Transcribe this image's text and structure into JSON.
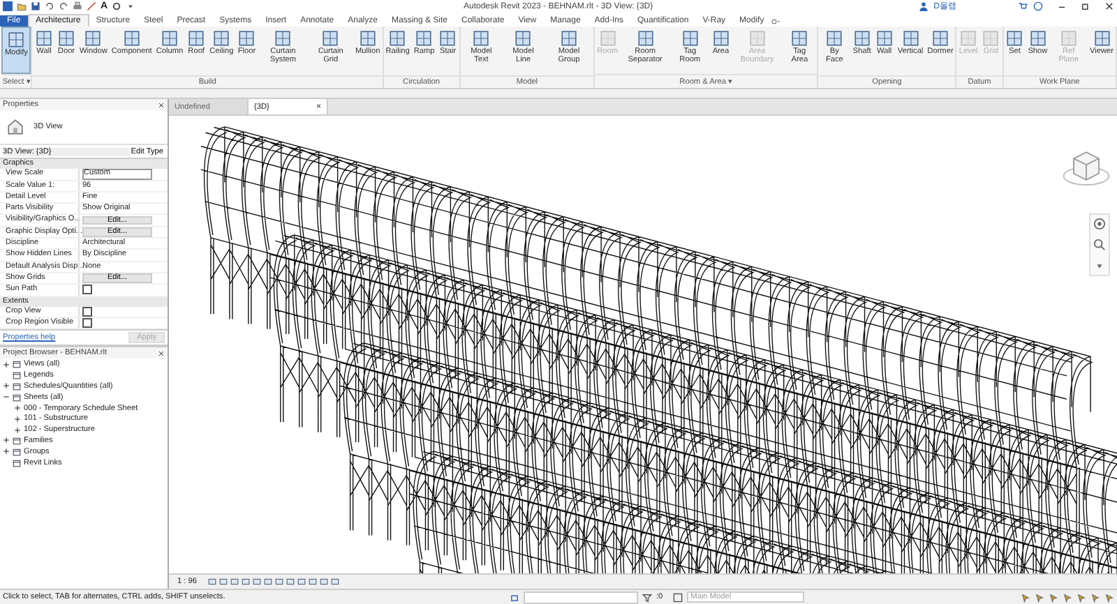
{
  "title_bar": {
    "title": "Autodesk Revit 2023 - BEHNAM.rlt - 3D View: {3D}",
    "user": "D올랩",
    "qat_text": "A"
  },
  "ribbon_tabs": [
    {
      "label": "File",
      "kind": "file",
      "selected": false
    },
    {
      "label": "Architecture",
      "kind": "tab",
      "selected": true
    },
    {
      "label": "Structure",
      "kind": "tab",
      "selected": false
    },
    {
      "label": "Steel",
      "kind": "tab",
      "selected": false
    },
    {
      "label": "Precast",
      "kind": "tab",
      "selected": false
    },
    {
      "label": "Systems",
      "kind": "tab",
      "selected": false
    },
    {
      "label": "Insert",
      "kind": "tab",
      "selected": false
    },
    {
      "label": "Annotate",
      "kind": "tab",
      "selected": false
    },
    {
      "label": "Analyze",
      "kind": "tab",
      "selected": false
    },
    {
      "label": "Massing & Site",
      "kind": "tab",
      "selected": false
    },
    {
      "label": "Collaborate",
      "kind": "tab",
      "selected": false
    },
    {
      "label": "View",
      "kind": "tab",
      "selected": false
    },
    {
      "label": "Manage",
      "kind": "tab",
      "selected": false
    },
    {
      "label": "Add-Ins",
      "kind": "tab",
      "selected": false
    },
    {
      "label": "Quantification",
      "kind": "tab",
      "selected": false
    },
    {
      "label": "V-Ray",
      "kind": "tab",
      "selected": false
    },
    {
      "label": "Modify",
      "kind": "tab",
      "selected": false
    }
  ],
  "ribbon_panels": [
    {
      "label": "Select ▾",
      "tools": [
        {
          "label": "Modify",
          "selected": true,
          "disabled": false
        }
      ]
    },
    {
      "label": "Build",
      "tools": [
        {
          "label": "Wall",
          "selected": false,
          "disabled": false
        },
        {
          "label": "Door",
          "selected": false,
          "disabled": false
        },
        {
          "label": "Window",
          "selected": false,
          "disabled": false
        },
        {
          "label": "Component",
          "selected": false,
          "disabled": false
        },
        {
          "label": "Column",
          "selected": false,
          "disabled": false
        },
        {
          "label": "Roof",
          "selected": false,
          "disabled": false
        },
        {
          "label": "Ceiling",
          "selected": false,
          "disabled": false
        },
        {
          "label": "Floor",
          "selected": false,
          "disabled": false
        },
        {
          "label": "Curtain System",
          "selected": false,
          "disabled": false
        },
        {
          "label": "Curtain Grid",
          "selected": false,
          "disabled": false
        },
        {
          "label": "Mullion",
          "selected": false,
          "disabled": false
        }
      ]
    },
    {
      "label": "Circulation",
      "tools": [
        {
          "label": "Railing",
          "selected": false,
          "disabled": false
        },
        {
          "label": "Ramp",
          "selected": false,
          "disabled": false
        },
        {
          "label": "Stair",
          "selected": false,
          "disabled": false
        }
      ]
    },
    {
      "label": "Model",
      "tools": [
        {
          "label": "Model Text",
          "selected": false,
          "disabled": false
        },
        {
          "label": "Model Line",
          "selected": false,
          "disabled": false
        },
        {
          "label": "Model Group",
          "selected": false,
          "disabled": false
        }
      ]
    },
    {
      "label": "Room & Area ▾",
      "tools": [
        {
          "label": "Room",
          "selected": false,
          "disabled": true
        },
        {
          "label": "Room Separator",
          "selected": false,
          "disabled": false
        },
        {
          "label": "Tag Room",
          "selected": false,
          "disabled": false
        },
        {
          "label": "Area",
          "selected": false,
          "disabled": false
        },
        {
          "label": "Area Boundary",
          "selected": false,
          "disabled": true
        },
        {
          "label": "Tag Area",
          "selected": false,
          "disabled": false
        }
      ]
    },
    {
      "label": "Opening",
      "tools": [
        {
          "label": "By Face",
          "selected": false,
          "disabled": false
        },
        {
          "label": "Shaft",
          "selected": false,
          "disabled": false
        },
        {
          "label": "Wall",
          "selected": false,
          "disabled": false
        },
        {
          "label": "Vertical",
          "selected": false,
          "disabled": false
        },
        {
          "label": "Dormer",
          "selected": false,
          "disabled": false
        }
      ]
    },
    {
      "label": "Datum",
      "tools": [
        {
          "label": "Level",
          "selected": false,
          "disabled": true
        },
        {
          "label": "Grid",
          "selected": false,
          "disabled": true
        }
      ]
    },
    {
      "label": "Work Plane",
      "tools": [
        {
          "label": "Set",
          "selected": false,
          "disabled": false
        },
        {
          "label": "Show",
          "selected": false,
          "disabled": false
        },
        {
          "label": "Ref Plane",
          "selected": false,
          "disabled": true
        },
        {
          "label": "Viewer",
          "selected": false,
          "disabled": false
        }
      ]
    }
  ],
  "properties": {
    "title": "Properties",
    "type_name": "3D View",
    "selector": "3D View: {3D}",
    "edit_type": "Edit Type",
    "rows": [
      {
        "kind": "group",
        "label": "Graphics"
      },
      {
        "kind": "field",
        "label": "View Scale",
        "value": "Custom"
      },
      {
        "kind": "text",
        "label": "Scale Value    1:",
        "value": "96"
      },
      {
        "kind": "text",
        "label": "Detail Level",
        "value": "Fine"
      },
      {
        "kind": "text",
        "label": "Parts Visibility",
        "value": "Show Original"
      },
      {
        "kind": "button",
        "label": "Visibility/Graphics O...",
        "value": "Edit..."
      },
      {
        "kind": "button",
        "label": "Graphic Display Opti...",
        "value": "Edit..."
      },
      {
        "kind": "text",
        "label": "Discipline",
        "value": "Architectural"
      },
      {
        "kind": "text",
        "label": "Show Hidden Lines",
        "value": "By Discipline"
      },
      {
        "kind": "text",
        "label": "Default Analysis Disp...",
        "value": "None"
      },
      {
        "kind": "button",
        "label": "Show Grids",
        "value": "Edit..."
      },
      {
        "kind": "checkbox",
        "label": "Sun Path",
        "checked": false
      },
      {
        "kind": "group",
        "label": "Extents"
      },
      {
        "kind": "checkbox",
        "label": "Crop View",
        "checked": false
      },
      {
        "kind": "checkbox",
        "label": "Crop Region Visible",
        "checked": false
      }
    ],
    "help_link": "Properties help",
    "apply": "Apply"
  },
  "project_browser": {
    "title": "Project Browser - BEHNAM.rlt",
    "tree": [
      {
        "label": "Views (all)",
        "expanded": false
      },
      {
        "label": "Legends"
      },
      {
        "label": "Schedules/Quantities (all)",
        "expanded": false
      },
      {
        "label": "Sheets (all)",
        "expanded": true,
        "children": [
          {
            "label": "000 - Temporary Schedule Sheet",
            "expanded": false
          },
          {
            "label": "101 - Substructure",
            "expanded": false
          },
          {
            "label": "102 - Superstructure",
            "expanded": false
          }
        ]
      },
      {
        "label": "Families",
        "expanded": false
      },
      {
        "label": "Groups",
        "expanded": false
      },
      {
        "label": "Revit Links"
      }
    ]
  },
  "view_tabs": [
    {
      "label": "Undefined",
      "selected": false
    },
    {
      "label": "{3D}",
      "selected": true,
      "close": "×"
    }
  ],
  "view_bar": {
    "scale": "1 : 96"
  },
  "status_bar": {
    "message": "Click to select, TAB for alternates, CTRL adds, SHIFT unselects.",
    "count": ":0",
    "model": "Main Model"
  }
}
